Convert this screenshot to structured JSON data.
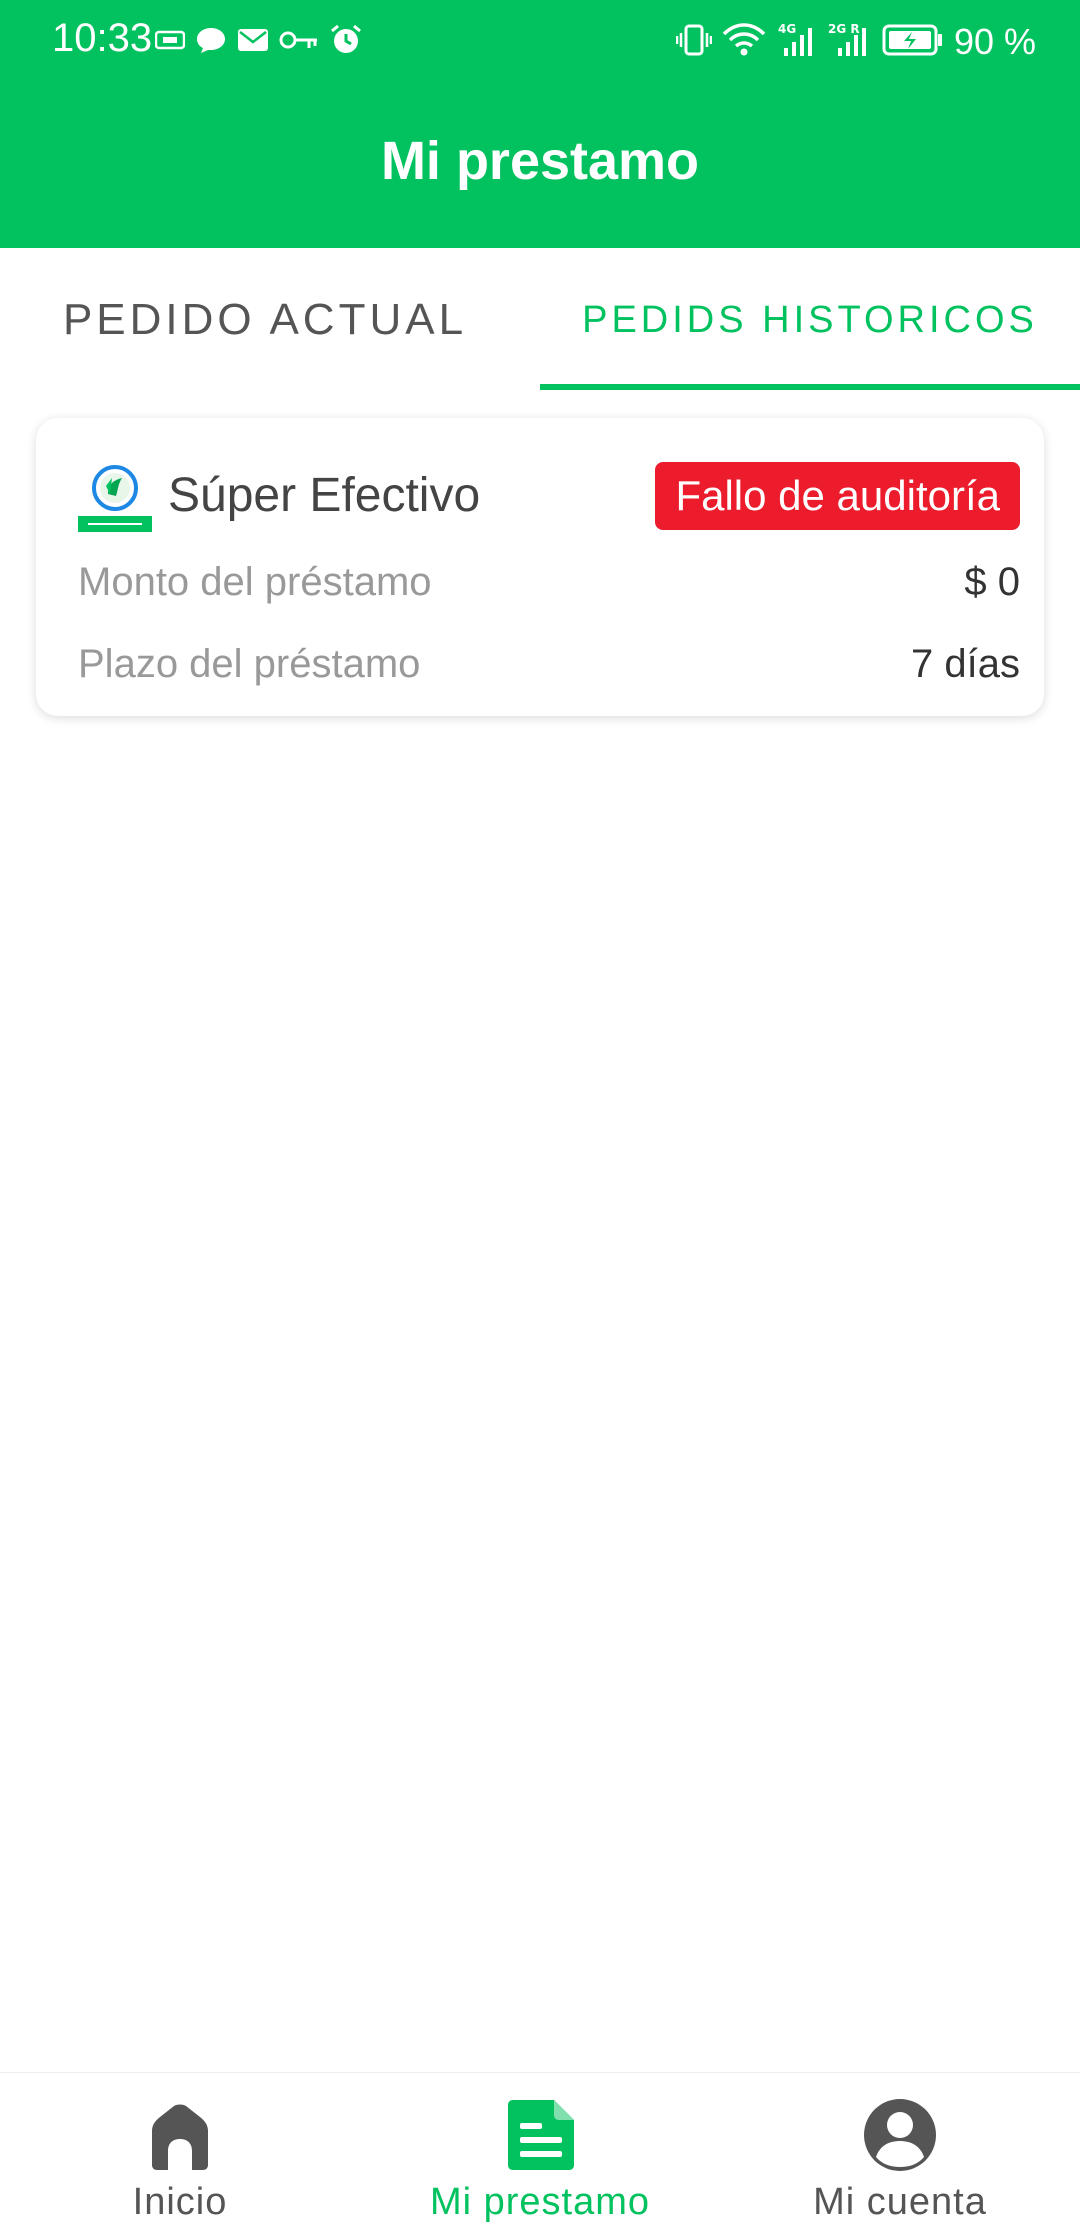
{
  "status_bar": {
    "time": "10:33",
    "battery": "90 %",
    "left_icons": [
      "sim-card-icon",
      "chat-bubble-icon",
      "mail-icon",
      "key-icon",
      "alarm-icon"
    ],
    "right_icons": [
      "vibrate-icon",
      "wifi-icon",
      "signal-4g-icon",
      "signal-2g-icon",
      "battery-charging-icon"
    ]
  },
  "header": {
    "title": "Mi prestamo",
    "color": "#02c25f"
  },
  "tabs": [
    {
      "label": "PEDIDO ACTUAL",
      "active": false
    },
    {
      "label": "PEDIDS HISTORICOS",
      "active": true
    }
  ],
  "order_card": {
    "brand": "Súper Efectivo",
    "status": "Fallo de auditoría",
    "status_color": "#ec1c2c",
    "amount_label": "Monto del préstamo",
    "amount_value": "$ 0",
    "term_label": "Plazo del préstamo",
    "term_value": "7 días"
  },
  "bottom_nav": [
    {
      "label": "Inicio",
      "icon": "home-icon",
      "active": false
    },
    {
      "label": "Mi prestamo",
      "icon": "document-icon",
      "active": true
    },
    {
      "label": "Mi cuenta",
      "icon": "account-icon",
      "active": false
    }
  ]
}
